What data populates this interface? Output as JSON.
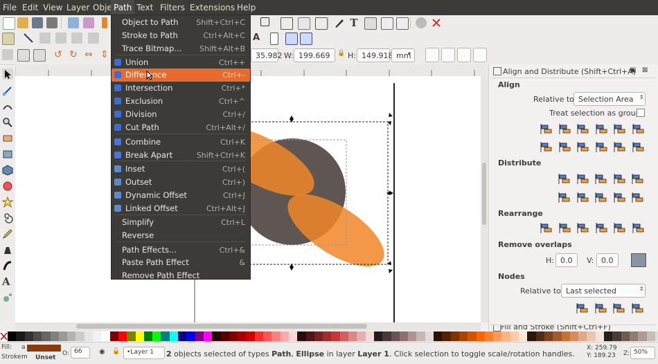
{
  "menubar": [
    "File",
    "Edit",
    "View",
    "Layer",
    "Object",
    "Path",
    "Text",
    "Filters",
    "Extensions",
    "Help"
  ],
  "path_menu": {
    "items": [
      {
        "label": "Object to Path",
        "shortcut": "Shift+Ctrl+C",
        "icon": ""
      },
      {
        "label": "Stroke to Path",
        "shortcut": "Ctrl+Alt+C",
        "icon": ""
      },
      {
        "label": "Trace Bitmap...",
        "shortcut": "Shift+Alt+B",
        "icon": ""
      },
      {
        "label": "Union",
        "shortcut": "Ctrl++",
        "icon": "union-icon"
      },
      {
        "label": "Difference",
        "shortcut": "Ctrl+-",
        "icon": "difference-icon",
        "highlighted": true
      },
      {
        "label": "Intersection",
        "shortcut": "Ctrl+*",
        "icon": "intersection-icon"
      },
      {
        "label": "Exclusion",
        "shortcut": "Ctrl+^",
        "icon": "exclusion-icon"
      },
      {
        "label": "Division",
        "shortcut": "Ctrl+/",
        "icon": "division-icon"
      },
      {
        "label": "Cut Path",
        "shortcut": "Ctrl+Alt+/",
        "icon": "cut-path-icon"
      },
      {
        "label": "Combine",
        "shortcut": "Ctrl+K",
        "icon": "combine-icon"
      },
      {
        "label": "Break Apart",
        "shortcut": "Shift+Ctrl+K",
        "icon": "break-apart-icon"
      },
      {
        "label": "Inset",
        "shortcut": "Ctrl+(",
        "icon": "inset-icon"
      },
      {
        "label": "Outset",
        "shortcut": "Ctrl+)",
        "icon": "outset-icon"
      },
      {
        "label": "Dynamic Offset",
        "shortcut": "Ctrl+J",
        "icon": "dynamic-offset-icon"
      },
      {
        "label": "Linked Offset",
        "shortcut": "Ctrl+Alt+J",
        "icon": "linked-offset-icon"
      },
      {
        "label": "Simplify",
        "shortcut": "Ctrl+L",
        "icon": ""
      },
      {
        "label": "Reverse",
        "shortcut": "",
        "icon": ""
      },
      {
        "label": "Path Effects...",
        "shortcut": "Ctrl+&",
        "icon": ""
      },
      {
        "label": "Paste Path Effect",
        "shortcut": "&",
        "icon": ""
      },
      {
        "label": "Remove Path Effect",
        "shortcut": "",
        "icon": ""
      }
    ]
  },
  "controls": {
    "x_value": "35.982",
    "w_label": "W:",
    "w_value": "199.669",
    "h_label": "H:",
    "h_value": "149.918",
    "unit": "mm"
  },
  "dock": {
    "title": "Align and Distribute (Shift+Ctrl+A)",
    "align_heading": "Align",
    "relative_label": "Relative to:",
    "relative_value": "Selection Area",
    "treat_group_label": "Treat selection as group:",
    "distribute_heading": "Distribute",
    "rearrange_heading": "Rearrange",
    "remove_overlaps_heading": "Remove overlaps",
    "h_label": "H:",
    "h_value": "0.0",
    "v_label": "V:",
    "v_value": "0.0",
    "nodes_heading": "Nodes",
    "nodes_relative_label": "Relative to:",
    "nodes_relative_value": "Last selected",
    "next_panel_title": "Fill and Stroke (Shift+Ctrl+F)"
  },
  "colors": {
    "accent": "#e86b2e",
    "circle": "#5f5654",
    "ellipse": "#f08628",
    "fill_swatch": "#8b3a0e"
  },
  "status": {
    "fill_label": "Fill:",
    "fill_value": "a",
    "stroke_label": "Stroke:",
    "stroke_value": "m",
    "stroke_unset": "Unset",
    "opacity_label": "O:",
    "opacity_value": "66",
    "layer": "•Layer 1",
    "count": "2",
    "msg_a": " objects selected of types ",
    "type1": "Path",
    "msg_b": ", ",
    "type2": "Ellipse",
    "msg_c": " in layer ",
    "layer_name": "Layer 1",
    "msg_d": ". Click selection to toggle scale/rotation handles.",
    "x_coord": "X: 259.79",
    "y_coord": "Y: 189.23",
    "zoom_label": "Z:",
    "zoom_value": "50%"
  }
}
